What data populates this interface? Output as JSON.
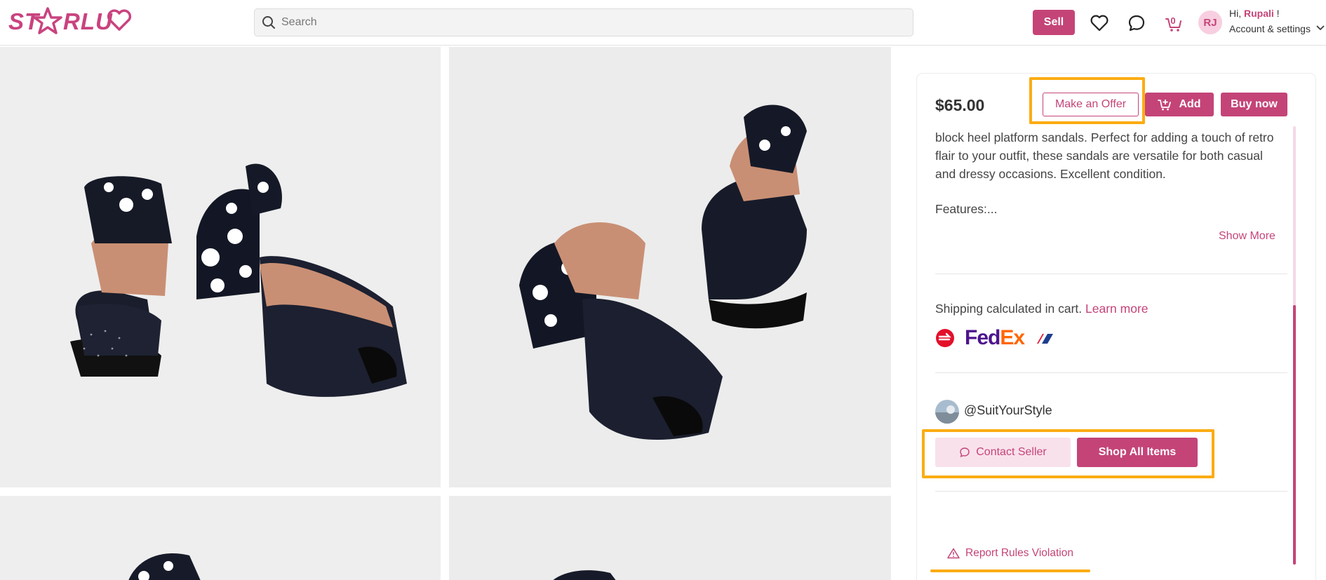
{
  "header": {
    "logo_text": "ST★RLU♡",
    "search_placeholder": "Search",
    "sell_label": "Sell",
    "cart_count": "0",
    "avatar_initials": "RJ",
    "greeting_prefix": "Hi, ",
    "user_name": "Rupali",
    "greeting_suffix": " !",
    "account_label": "Account & settings"
  },
  "product": {
    "price": "$65.00",
    "offer_label": "Make an Offer",
    "add_label": "Add",
    "buy_label": "Buy now",
    "description": "block heel platform sandals.  Perfect for adding a touch of retro flair to your outfit, these sandals are versatile for both casual and dressy occasions.  Excellent condition.",
    "features": "Features:...",
    "show_more": "Show More"
  },
  "shipping": {
    "text": "Shipping calculated in cart. ",
    "link": "Learn more",
    "carriers": [
      "Canada Post",
      "FedEx",
      "Purolator"
    ],
    "fedex_text_1": "Fed",
    "fedex_text_2": "Ex"
  },
  "seller": {
    "handle": "@SuitYourStyle",
    "contact_label": "Contact Seller",
    "shop_label": "Shop All Items"
  },
  "report_label": "Report Rules Violation",
  "colors": {
    "brand": "#c44478",
    "highlight": "#fbac13"
  }
}
